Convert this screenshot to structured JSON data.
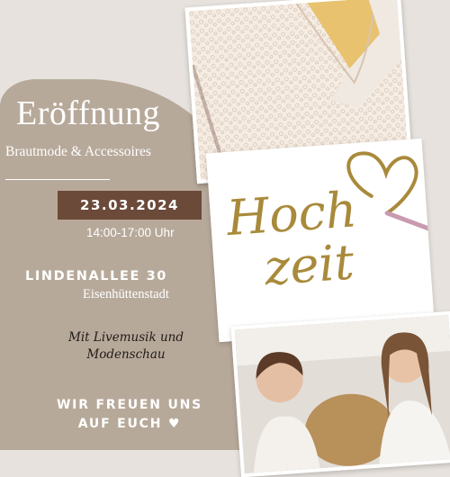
{
  "headline": {
    "title": "Eröffnung",
    "subtitle": "Brautmode & Accessoires"
  },
  "event": {
    "date": "23.03.2024",
    "time": "14:00-17:00 Uhr"
  },
  "address": {
    "street": "LINDENALLEE 30",
    "city": "Eisenhüttenstadt"
  },
  "extras": {
    "line1": "Mit Livemusik und",
    "line2": "Modenschau"
  },
  "closing": {
    "line1": "WIR FREUEN UNS",
    "line2": "AUF EUCH"
  },
  "hochzeit_logo": {
    "line1": "Hoch",
    "line2": "zeit"
  },
  "icons": [
    "heart-icon",
    "heart-outline-icon"
  ],
  "colors": {
    "background": "#e7e2dd",
    "panel": "#b7a99a",
    "date_box": "#6b4a3a",
    "gold": "#a98a3b",
    "heart_pink": "#c99ab0"
  }
}
